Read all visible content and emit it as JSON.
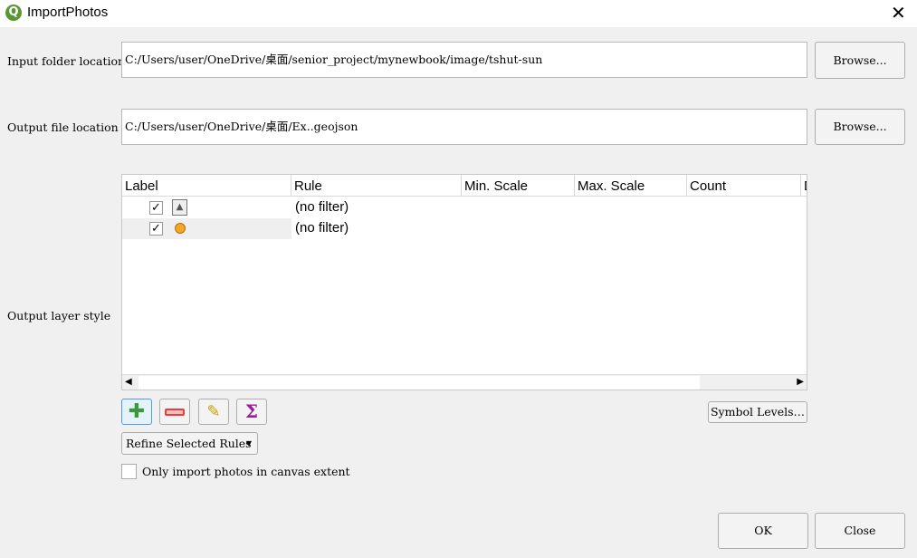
{
  "window": {
    "title": "ImportPhotos",
    "close_icon": "close-icon"
  },
  "input_folder": {
    "label": "Input folder location",
    "value": "C:/Users/user/OneDrive/桌面/senior_project/mynewbook/image/tshut-sun",
    "browse": "Browse..."
  },
  "output_file": {
    "label": "Output file location",
    "value": "C:/Users/user/OneDrive/桌面/Ex..geojson",
    "browse": "Browse..."
  },
  "style": {
    "label": "Output layer style",
    "columns": [
      "Label",
      "Rule",
      "Min. Scale",
      "Max. Scale",
      "Count",
      "D"
    ],
    "rows": [
      {
        "checked": true,
        "symbol": "image-icon",
        "rule": "(no filter)"
      },
      {
        "checked": true,
        "symbol": "orange-circle",
        "symbol_color": "#f5a623",
        "rule": "(no filter)"
      }
    ],
    "check_mark": "✓",
    "symbol_levels": "Symbol Levels…",
    "refine": "Refine Selected Rules",
    "sigma": "Σ"
  },
  "canvas_extent": {
    "label": "Only import photos in canvas extent",
    "checked": false
  },
  "footer": {
    "ok": "OK",
    "close": "Close"
  }
}
